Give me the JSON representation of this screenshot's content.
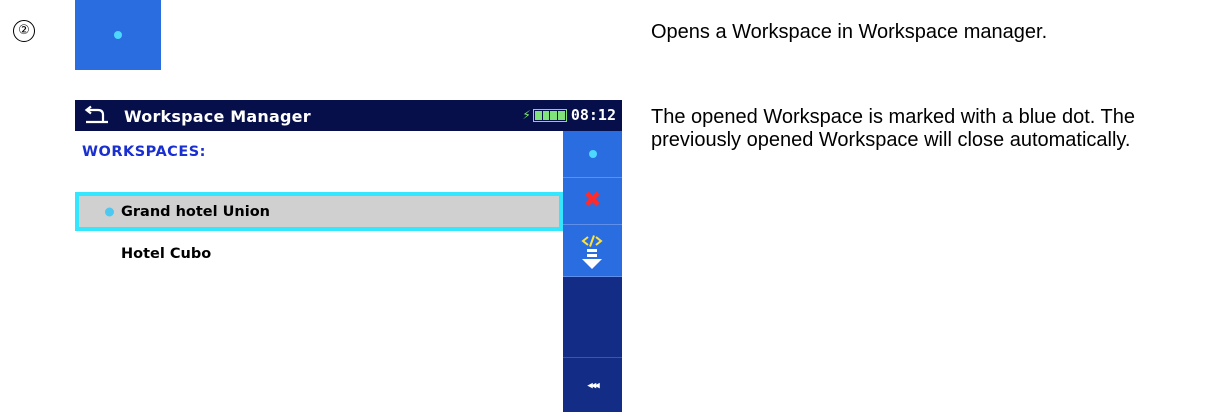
{
  "step": {
    "marker": "②"
  },
  "device": {
    "header": {
      "title": "Workspace Manager",
      "time": "08:12"
    },
    "section_heading": "WORKSPACES:",
    "workspaces": [
      {
        "name": "Grand hotel Union",
        "opened": true,
        "selected": true
      },
      {
        "name": "Hotel Cubo",
        "opened": false,
        "selected": false
      }
    ],
    "side_buttons": [
      "open-icon",
      "delete-icon",
      "export-icon",
      "collapse-icon"
    ],
    "collapse_glyph": "◂◂◂"
  },
  "description": {
    "p1": "Opens a Workspace in Workspace manager.",
    "p2": "The opened Workspace is marked with a blue dot. The previously opened Workspace will close automatically."
  },
  "colors": {
    "title_bar": "#070f4a",
    "side_panel": "#132c86",
    "button_blue": "#2a6de0",
    "selection_border": "#35e6ff",
    "heading_blue": "#1a2fd0",
    "dot": "#4dd8ff",
    "battery": "#7fe27a",
    "delete_red": "#ff2a2a"
  }
}
